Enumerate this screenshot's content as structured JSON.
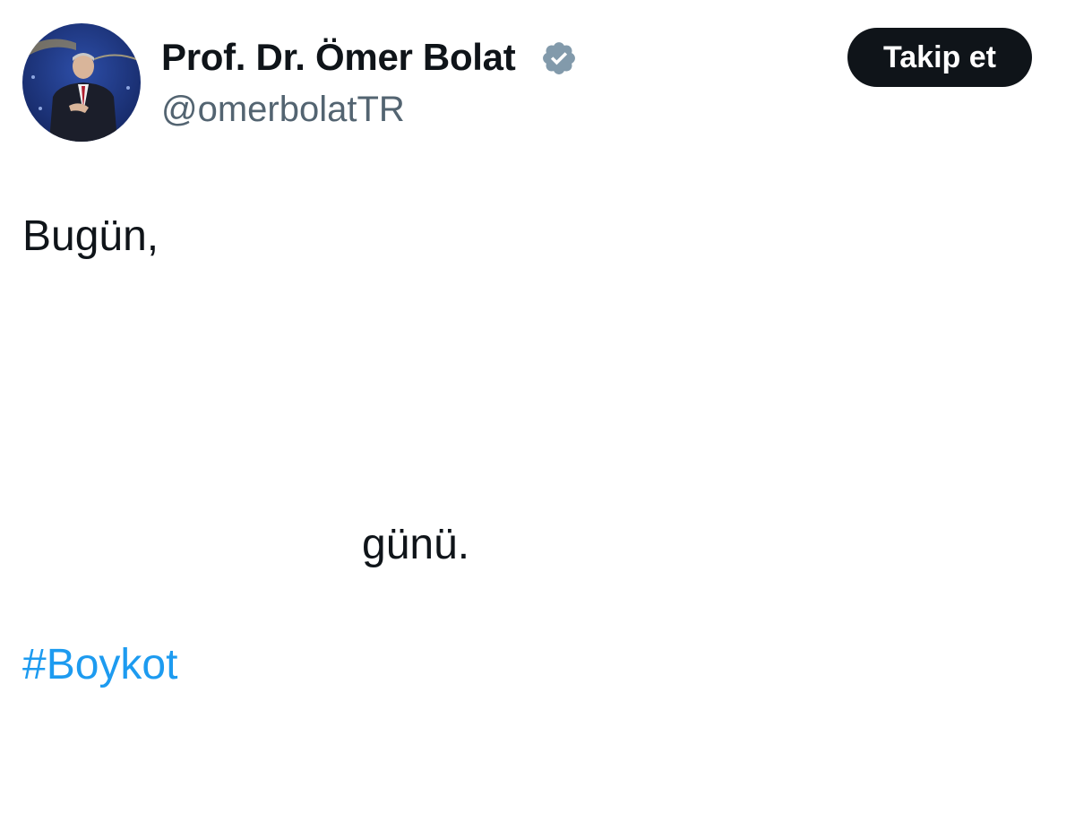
{
  "profile": {
    "display_name": "Prof. Dr. Ömer Bolat",
    "handle": "@omerbolatTR",
    "verified_icon": "verified-badge-icon",
    "avatar": "avatar-photo"
  },
  "actions": {
    "follow_label": "Takip et"
  },
  "tweet": {
    "line_1": "Bugün,",
    "line_2": "günü.",
    "hashtag": "#Boykot"
  },
  "colors": {
    "text": "#0f1419",
    "secondary_text": "#536471",
    "link": "#1d9bf0",
    "verified_badge": "#829aab",
    "button_bg": "#0f1419"
  }
}
